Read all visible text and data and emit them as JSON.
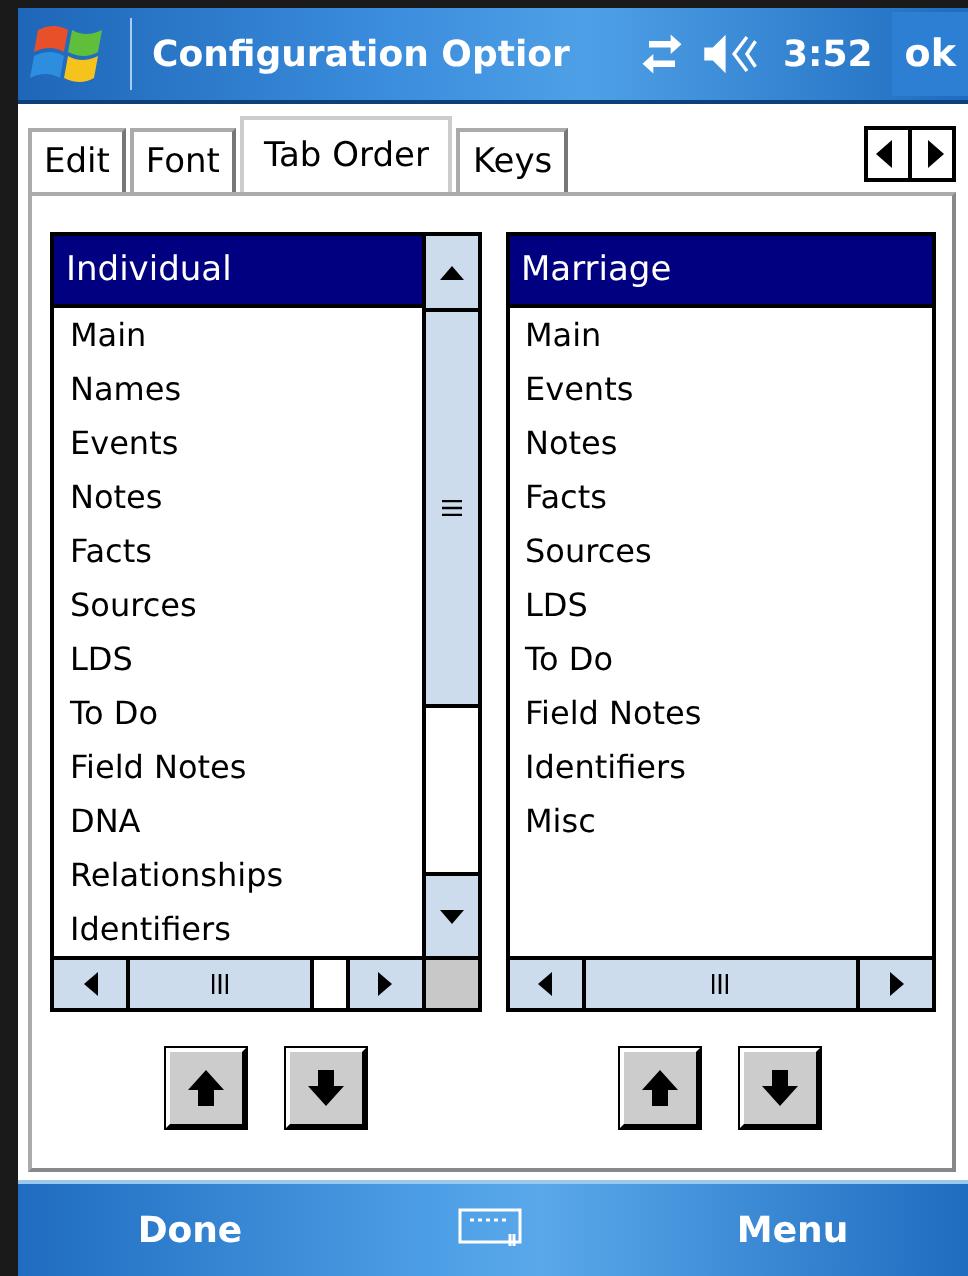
{
  "window": {
    "title": "Configuration Optior",
    "time": "3:52",
    "ok_button": "ok"
  },
  "tabs": [
    {
      "label": "Edit",
      "selected": false
    },
    {
      "label": "Font",
      "selected": false
    },
    {
      "label": "Tab Order",
      "selected": true
    },
    {
      "label": "Keys",
      "selected": false
    }
  ],
  "lists": [
    {
      "header": "Individual",
      "vertical_scrollbar": true,
      "items": [
        "Main",
        "Names",
        "Events",
        "Notes",
        "Facts",
        "Sources",
        "LDS",
        "To Do",
        "Field Notes",
        "DNA",
        "Relationships",
        "Identifiers"
      ]
    },
    {
      "header": "Marriage",
      "vertical_scrollbar": false,
      "items": [
        "Main",
        "Events",
        "Notes",
        "Facts",
        "Sources",
        "LDS",
        "To Do",
        "Field Notes",
        "Identifiers",
        "Misc"
      ]
    }
  ],
  "softkeys": {
    "left": "Done",
    "right": "Menu"
  }
}
